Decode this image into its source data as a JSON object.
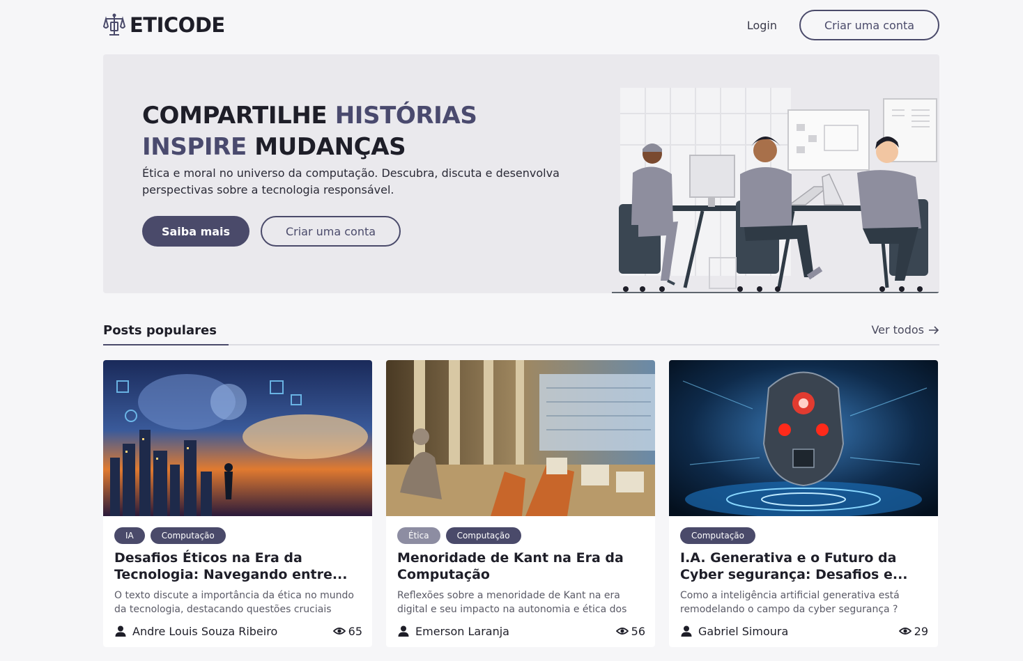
{
  "header": {
    "logo_text": "ETICODE",
    "login_label": "Login",
    "signup_label": "Criar uma conta"
  },
  "hero": {
    "title_line1_dark": "COMPARTILHE",
    "title_line1_accent": "HISTÓRIAS",
    "title_line2_accent": "INSPIRE",
    "title_line2_dark": "MUDANÇAS",
    "subtitle": "Ética e moral no universo da computação. Descubra, discuta e desenvolva perspectivas sobre a tecnologia responsável.",
    "primary_label": "Saiba mais",
    "secondary_label": "Criar uma conta"
  },
  "section": {
    "title": "Posts populares",
    "see_all_label": "Ver todos"
  },
  "posts": [
    {
      "tags": [
        "IA",
        "Computação"
      ],
      "title": "Desafios Éticos na Era da Tecnologia: Navegando entre...",
      "description": "O texto discute a importância da ética no mundo da tecnologia, destacando questões cruciais surgidas...",
      "author": "Andre Louis Souza Ribeiro",
      "views": "65"
    },
    {
      "tags": [
        "Ética",
        "Computação"
      ],
      "title": "Menoridade de Kant na Era da Computação",
      "description": "Reflexões sobre a menoridade de Kant na era digital e seu impacto na autonomia e ética dos profissiona...",
      "author": "Emerson Laranja",
      "views": "56"
    },
    {
      "tags": [
        "Computação"
      ],
      "title": "I.A. Generativa e o Futuro da Cyber segurança: Desafios e...",
      "description": "Como a inteligência artificial generativa está remodelando o campo da cyber segurança ? Quais...",
      "author": "Gabriel Simoura",
      "views": "29"
    }
  ],
  "colors": {
    "accent": "#4a4a6a",
    "hero_bg": "#eae9ed",
    "page_bg": "#f6f6f8"
  }
}
